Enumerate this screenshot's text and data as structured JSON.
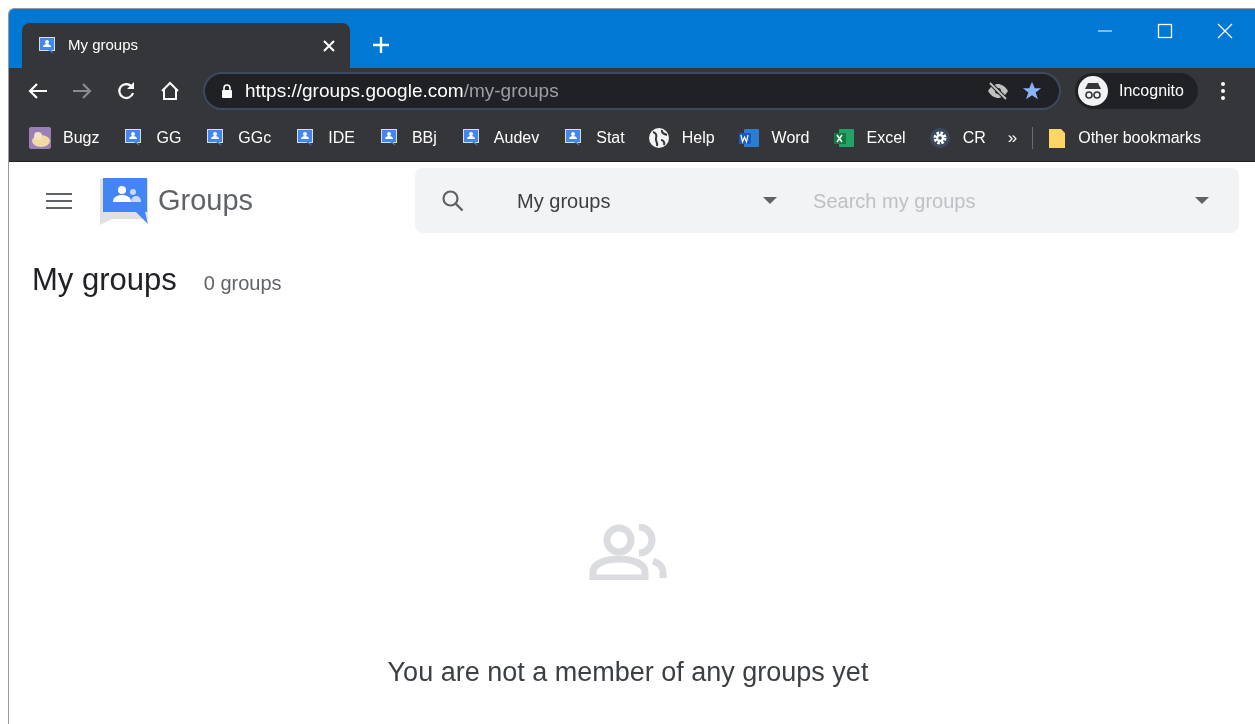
{
  "tab": {
    "title": "My groups",
    "selected": true
  },
  "address": {
    "host": "https://groups.google.com",
    "path": "/my-groups"
  },
  "profile": {
    "label": "Incognito"
  },
  "bookmarks": [
    {
      "label": "Bugz",
      "kind": "picture"
    },
    {
      "label": "GG",
      "kind": "groups"
    },
    {
      "label": "GGc",
      "kind": "groups"
    },
    {
      "label": "IDE",
      "kind": "groups"
    },
    {
      "label": "BBj",
      "kind": "groups"
    },
    {
      "label": "Audev",
      "kind": "groups"
    },
    {
      "label": "Stat",
      "kind": "groups"
    },
    {
      "label": "Help",
      "kind": "globe"
    },
    {
      "label": "Word",
      "kind": "word"
    },
    {
      "label": "Excel",
      "kind": "excel"
    },
    {
      "label": "CR",
      "kind": "gear"
    }
  ],
  "bookmarks_overflow": "»",
  "other_bookmarks": "Other bookmarks",
  "app": {
    "name": "Groups",
    "search": {
      "scope": "My groups",
      "placeholder": "Search my groups"
    }
  },
  "heading": "My groups",
  "count": "0 groups",
  "empty_message": "You are not a member of any groups yet"
}
